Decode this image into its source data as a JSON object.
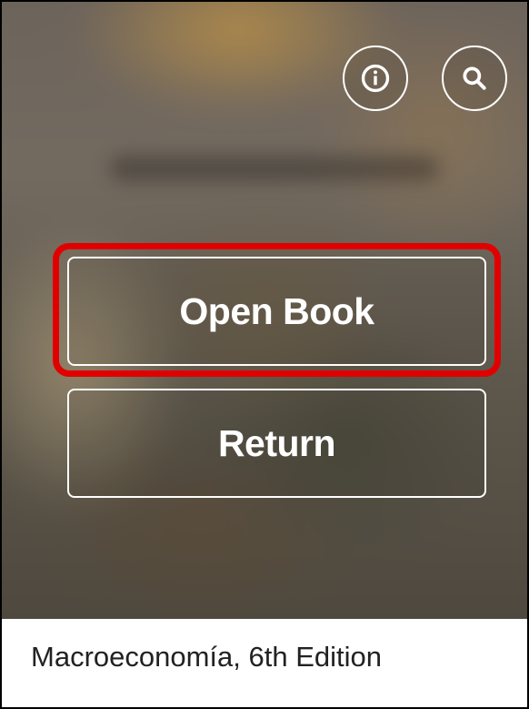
{
  "cover": {
    "info_icon": "info-icon",
    "search_icon": "search-icon",
    "buttons": {
      "open_book": "Open Book",
      "return": "Return"
    },
    "highlight_color": "#e10000"
  },
  "book": {
    "title": "Macroeconomía, 6th Edition"
  }
}
